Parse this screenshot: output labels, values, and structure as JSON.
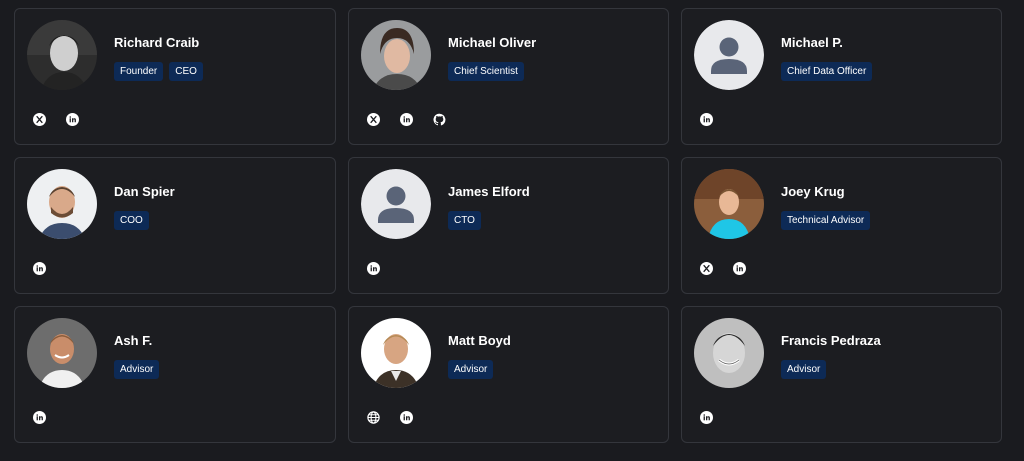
{
  "team": [
    {
      "name": "Richard Craib",
      "roles": [
        "Founder",
        "CEO"
      ],
      "avatar": "photo-dark-hair",
      "socials": [
        "x-icon",
        "linkedin-icon"
      ]
    },
    {
      "name": "Michael Oliver",
      "roles": [
        "Chief Scientist"
      ],
      "avatar": "photo-long-hair",
      "socials": [
        "x-icon",
        "linkedin-icon",
        "github-icon"
      ]
    },
    {
      "name": "Michael P.",
      "roles": [
        "Chief Data Officer"
      ],
      "avatar": "placeholder",
      "socials": [
        "linkedin-icon"
      ]
    },
    {
      "name": "Dan Spier",
      "roles": [
        "COO"
      ],
      "avatar": "photo-beard",
      "socials": [
        "linkedin-icon"
      ]
    },
    {
      "name": "James Elford",
      "roles": [
        "CTO"
      ],
      "avatar": "placeholder",
      "socials": [
        "linkedin-icon"
      ]
    },
    {
      "name": "Joey Krug",
      "roles": [
        "Technical Advisor"
      ],
      "avatar": "photo-blue-shirt",
      "socials": [
        "x-icon",
        "linkedin-icon"
      ]
    },
    {
      "name": "Ash F.",
      "roles": [
        "Advisor"
      ],
      "avatar": "photo-smiling",
      "socials": [
        "linkedin-icon"
      ]
    },
    {
      "name": "Matt Boyd",
      "roles": [
        "Advisor"
      ],
      "avatar": "photo-white-bg",
      "socials": [
        "globe-icon",
        "linkedin-icon"
      ]
    },
    {
      "name": "Francis Pedraza",
      "roles": [
        "Advisor"
      ],
      "avatar": "photo-bw",
      "socials": [
        "linkedin-icon"
      ]
    }
  ],
  "colors": {
    "background": "#1a1b1f",
    "card_background": "#1c1d21",
    "card_border": "#34363c",
    "badge_background": "#0d2a56",
    "placeholder_circle": "#e8e9ec",
    "placeholder_glyph": "#5a6478"
  }
}
